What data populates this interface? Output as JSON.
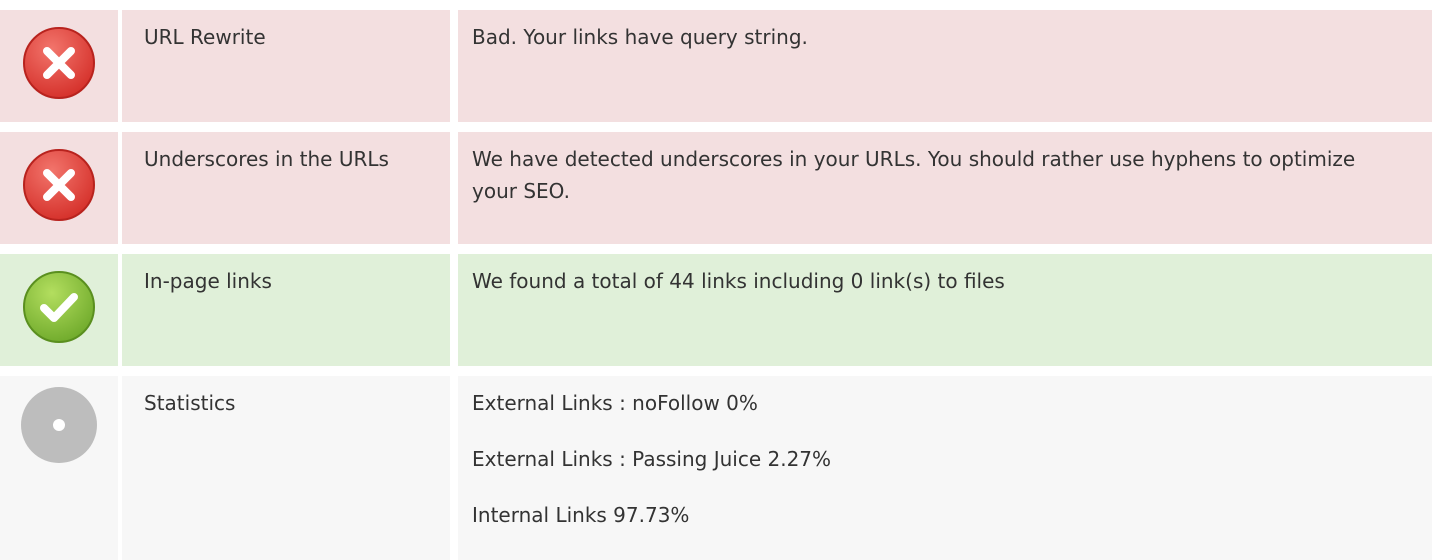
{
  "colors": {
    "bad_row": "#f3dfe0",
    "good_row": "#e0f0d9",
    "neutral_row": "#f7f7f7",
    "error_icon": "#e4413b",
    "success_icon": "#8cc63e",
    "neutral_icon": "#bdbdbd"
  },
  "rows": [
    {
      "status": "error",
      "icon": "error-x-icon",
      "label": "URL Rewrite",
      "description": "Bad. Your links have query string."
    },
    {
      "status": "error",
      "icon": "error-x-icon",
      "label": "Underscores in the URLs",
      "description": "We have detected underscores in your URLs. You should rather use hyphens to optimize your SEO."
    },
    {
      "status": "success",
      "icon": "check-icon",
      "label": "In-page links",
      "description": "We found a total of 44 links including 0 link(s) to files"
    },
    {
      "status": "neutral",
      "icon": "info-dot-icon",
      "label": "Statistics",
      "stats": [
        "External Links : noFollow 0%",
        "External Links : Passing Juice 2.27%",
        "Internal Links 97.73%"
      ]
    }
  ]
}
